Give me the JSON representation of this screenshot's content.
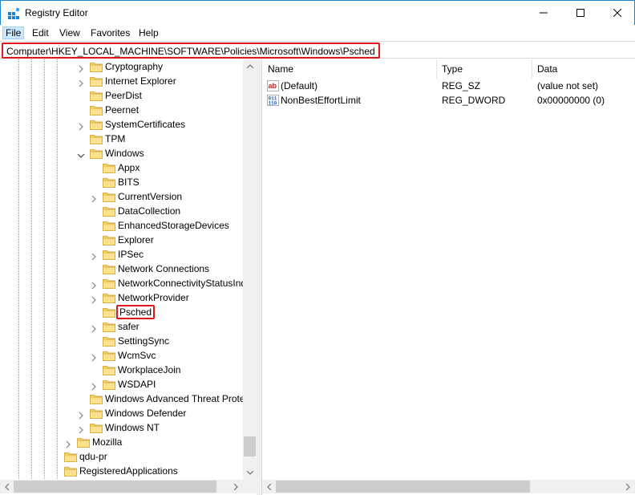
{
  "window": {
    "title": "Registry Editor",
    "accent_color": "#1883d7",
    "highlight_color": "#e0161c"
  },
  "menu": [
    "File",
    "Edit",
    "View",
    "Favorites",
    "Help"
  ],
  "address": {
    "path": "Computer\\HKEY_LOCAL_MACHINE\\SOFTWARE\\Policies\\Microsoft\\Windows\\Psched"
  },
  "tree": {
    "items": [
      {
        "label": "Cryptography",
        "depth": 1,
        "expander": "collapsed"
      },
      {
        "label": "Internet Explorer",
        "depth": 1,
        "expander": "collapsed"
      },
      {
        "label": "PeerDist",
        "depth": 1,
        "expander": "none"
      },
      {
        "label": "Peernet",
        "depth": 1,
        "expander": "none"
      },
      {
        "label": "SystemCertificates",
        "depth": 1,
        "expander": "collapsed"
      },
      {
        "label": "TPM",
        "depth": 1,
        "expander": "none"
      },
      {
        "label": "Windows",
        "depth": 1,
        "expander": "expanded"
      },
      {
        "label": "Appx",
        "depth": 2,
        "expander": "none"
      },
      {
        "label": "BITS",
        "depth": 2,
        "expander": "none"
      },
      {
        "label": "CurrentVersion",
        "depth": 2,
        "expander": "collapsed"
      },
      {
        "label": "DataCollection",
        "depth": 2,
        "expander": "none"
      },
      {
        "label": "EnhancedStorageDevices",
        "depth": 2,
        "expander": "none"
      },
      {
        "label": "Explorer",
        "depth": 2,
        "expander": "none"
      },
      {
        "label": "IPSec",
        "depth": 2,
        "expander": "collapsed"
      },
      {
        "label": "Network Connections",
        "depth": 2,
        "expander": "none"
      },
      {
        "label": "NetworkConnectivityStatusIndica",
        "depth": 2,
        "expander": "collapsed"
      },
      {
        "label": "NetworkProvider",
        "depth": 2,
        "expander": "collapsed"
      },
      {
        "label": "Psched",
        "depth": 2,
        "expander": "none",
        "selected": true
      },
      {
        "label": "safer",
        "depth": 2,
        "expander": "collapsed"
      },
      {
        "label": "SettingSync",
        "depth": 2,
        "expander": "none"
      },
      {
        "label": "WcmSvc",
        "depth": 2,
        "expander": "collapsed"
      },
      {
        "label": "WorkplaceJoin",
        "depth": 2,
        "expander": "none"
      },
      {
        "label": "WSDAPI",
        "depth": 2,
        "expander": "collapsed"
      },
      {
        "label": "Windows Advanced Threat Protectic",
        "depth": 1,
        "expander": "none"
      },
      {
        "label": "Windows Defender",
        "depth": 1,
        "expander": "collapsed"
      },
      {
        "label": "Windows NT",
        "depth": 1,
        "expander": "collapsed"
      },
      {
        "label": "Mozilla",
        "depth": 0,
        "expander": "collapsed"
      },
      {
        "label": "qdu-pr",
        "depth": -1,
        "expander": "none"
      },
      {
        "label": "RegisteredApplications",
        "depth": -1,
        "expander": "none"
      }
    ]
  },
  "list": {
    "columns": [
      "Name",
      "Type",
      "Data"
    ],
    "rows": [
      {
        "name": "(Default)",
        "type": "REG_SZ",
        "data": "(value not set)",
        "icon": "string-value-icon"
      },
      {
        "name": "NonBestEffortLimit",
        "type": "REG_DWORD",
        "data": "0x00000000 (0)",
        "icon": "binary-value-icon"
      }
    ]
  }
}
